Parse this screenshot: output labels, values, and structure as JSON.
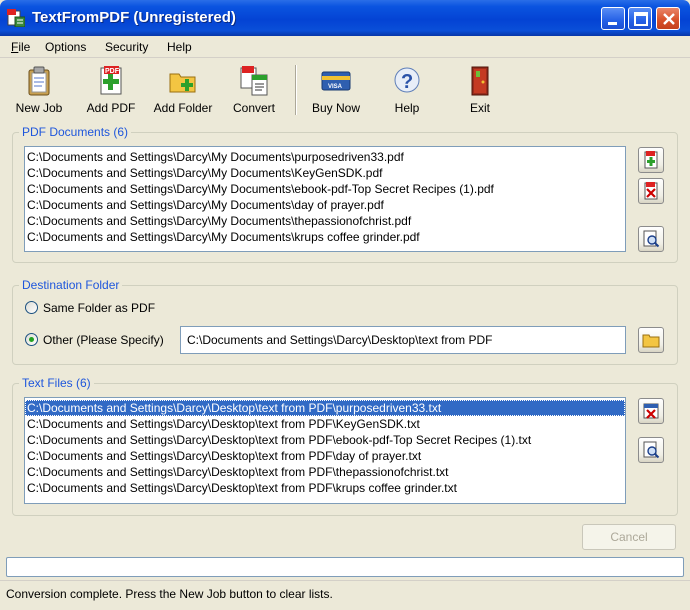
{
  "window": {
    "title": "TextFromPDF (Unregistered)",
    "accent": "#0443d4"
  },
  "menu": [
    {
      "label": "File",
      "ul": "F",
      "rest": "ile"
    },
    {
      "label": "Options",
      "ul": "",
      "rest": "Options"
    },
    {
      "label": "Security",
      "ul": "",
      "rest": "Security"
    },
    {
      "label": "Help",
      "ul": "",
      "rest": "Help"
    }
  ],
  "toolbar": {
    "new_job": "New Job",
    "add_pdf": "Add PDF",
    "add_folder": "Add Folder",
    "convert": "Convert",
    "buy_now": "Buy Now",
    "help": "Help",
    "exit": "Exit"
  },
  "pdf_documents": {
    "legend": "PDF Documents (6)",
    "items": [
      "C:\\Documents and Settings\\Darcy\\My Documents\\purposedriven33.pdf",
      "C:\\Documents and Settings\\Darcy\\My Documents\\KeyGenSDK.pdf",
      "C:\\Documents and Settings\\Darcy\\My Documents\\ebook-pdf-Top Secret Recipes (1).pdf",
      "C:\\Documents and Settings\\Darcy\\My Documents\\day of prayer.pdf",
      "C:\\Documents and Settings\\Darcy\\My Documents\\thepassionofchrist.pdf",
      "C:\\Documents and Settings\\Darcy\\My Documents\\krups coffee grinder.pdf"
    ]
  },
  "destination": {
    "legend": "Destination Folder",
    "same_folder_label": "Same Folder as PDF",
    "other_label": "Other (Please Specify)",
    "selected": "other",
    "path_value": "C:\\Documents and Settings\\Darcy\\Desktop\\text from PDF"
  },
  "text_files": {
    "legend": "Text Files (6)",
    "selected_index": 0,
    "items": [
      "C:\\Documents and Settings\\Darcy\\Desktop\\text from PDF\\purposedriven33.txt",
      "C:\\Documents and Settings\\Darcy\\Desktop\\text from PDF\\KeyGenSDK.txt",
      "C:\\Documents and Settings\\Darcy\\Desktop\\text from PDF\\ebook-pdf-Top Secret Recipes (1).txt",
      "C:\\Documents and Settings\\Darcy\\Desktop\\text from PDF\\day of prayer.txt",
      "C:\\Documents and Settings\\Darcy\\Desktop\\text from PDF\\thepassionofchrist.txt",
      "C:\\Documents and Settings\\Darcy\\Desktop\\text from PDF\\krups coffee grinder.txt"
    ]
  },
  "cancel_label": "Cancel",
  "progress": 0,
  "status_text": "Conversion complete. Press the New Job button to clear lists.",
  "icons": {
    "app": "pdf-text-icon",
    "new_job": "clipboard-icon",
    "add_pdf": "add-pdf-icon",
    "add_folder": "add-folder-icon",
    "convert": "convert-icon",
    "buy_now": "credit-card-icon",
    "help": "help-question-icon",
    "exit": "exit-door-icon"
  }
}
